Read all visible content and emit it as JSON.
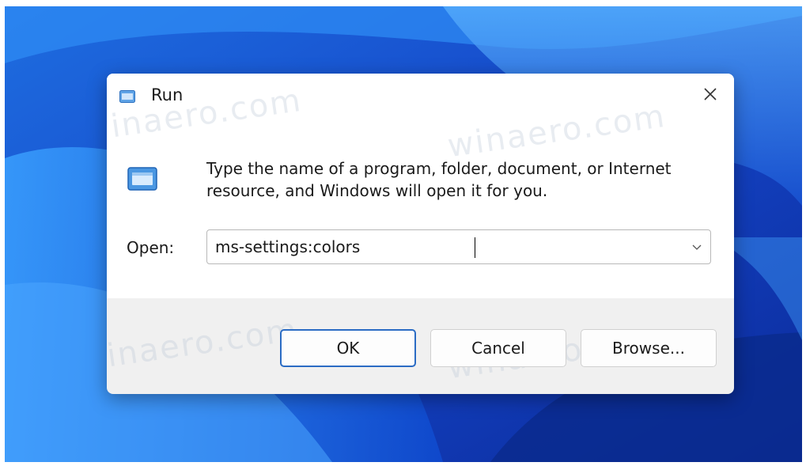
{
  "dialog": {
    "title": "Run",
    "description": "Type the name of a program, folder, document, or Internet resource, and Windows will open it for you.",
    "open_label": "Open:",
    "open_value": "ms-settings:colors",
    "buttons": {
      "ok": "OK",
      "cancel": "Cancel",
      "browse": "Browse..."
    }
  },
  "icons": {
    "title": "run-app-icon",
    "main": "run-app-icon",
    "close": "close-icon",
    "dropdown": "chevron-down-icon"
  },
  "watermark": "winaero.com",
  "colors": {
    "accent": "#2b6cc4",
    "dialog_body": "#ffffff",
    "dialog_footer": "#f0f0f0"
  }
}
